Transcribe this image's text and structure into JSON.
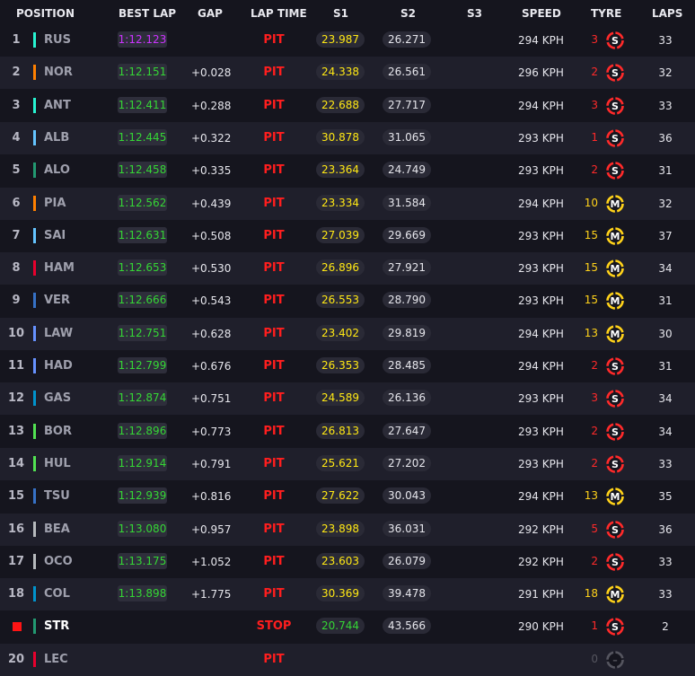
{
  "headers": {
    "position": "POSITION",
    "best_lap": "BEST LAP",
    "gap": "GAP",
    "lap_time": "LAP TIME",
    "s1": "S1",
    "s2": "S2",
    "s3": "S3",
    "speed": "SPEED",
    "tyre": "TYRE",
    "laps": "LAPS"
  },
  "colors": {
    "purple": "#cc33ff",
    "green": "#35d635",
    "yellow": "#ffe814",
    "red": "#ff1e1e",
    "soft": "#ff2a2a",
    "medium": "#ffd21a",
    "unknown": "#55555f",
    "mercedes": "#27f4d2",
    "mclaren": "#ff8000",
    "williams": "#64c4ff",
    "aston_martin": "#229971",
    "ferrari": "#e8002d",
    "red_bull": "#3671c6",
    "racing_bulls": "#6692ff",
    "alpine": "#0093cc",
    "sauber": "#52e252",
    "haas": "#b6babd"
  },
  "rows": [
    {
      "pos": "1",
      "driver": "RUS",
      "team_color": "#27f4d2",
      "best_lap": "1:12.123",
      "best_class": "purple",
      "gap": "",
      "lap_time": "PIT",
      "s1": "23.987",
      "s1_class": "yellow",
      "s2": "26.271",
      "speed": "294 KPH",
      "tyre_age": "3",
      "tyre": "soft",
      "tyre_letter": "S",
      "laps": "33"
    },
    {
      "pos": "2",
      "driver": "NOR",
      "team_color": "#ff8000",
      "best_lap": "1:12.151",
      "best_class": "green",
      "gap": "+0.028",
      "lap_time": "PIT",
      "s1": "24.338",
      "s1_class": "yellow",
      "s2": "26.561",
      "speed": "296 KPH",
      "tyre_age": "2",
      "tyre": "soft",
      "tyre_letter": "S",
      "laps": "32"
    },
    {
      "pos": "3",
      "driver": "ANT",
      "team_color": "#27f4d2",
      "best_lap": "1:12.411",
      "best_class": "green",
      "gap": "+0.288",
      "lap_time": "PIT",
      "s1": "22.688",
      "s1_class": "yellow",
      "s2": "27.717",
      "speed": "294 KPH",
      "tyre_age": "3",
      "tyre": "soft",
      "tyre_letter": "S",
      "laps": "33"
    },
    {
      "pos": "4",
      "driver": "ALB",
      "team_color": "#64c4ff",
      "best_lap": "1:12.445",
      "best_class": "green",
      "gap": "+0.322",
      "lap_time": "PIT",
      "s1": "30.878",
      "s1_class": "yellow",
      "s2": "31.065",
      "speed": "293 KPH",
      "tyre_age": "1",
      "tyre": "soft",
      "tyre_letter": "S",
      "laps": "36"
    },
    {
      "pos": "5",
      "driver": "ALO",
      "team_color": "#229971",
      "best_lap": "1:12.458",
      "best_class": "green",
      "gap": "+0.335",
      "lap_time": "PIT",
      "s1": "23.364",
      "s1_class": "yellow",
      "s2": "24.749",
      "speed": "293 KPH",
      "tyre_age": "2",
      "tyre": "soft",
      "tyre_letter": "S",
      "laps": "31"
    },
    {
      "pos": "6",
      "driver": "PIA",
      "team_color": "#ff8000",
      "best_lap": "1:12.562",
      "best_class": "green",
      "gap": "+0.439",
      "lap_time": "PIT",
      "s1": "23.334",
      "s1_class": "yellow",
      "s2": "31.584",
      "speed": "294 KPH",
      "tyre_age": "10",
      "tyre": "medium",
      "tyre_letter": "M",
      "laps": "32"
    },
    {
      "pos": "7",
      "driver": "SAI",
      "team_color": "#64c4ff",
      "best_lap": "1:12.631",
      "best_class": "green",
      "gap": "+0.508",
      "lap_time": "PIT",
      "s1": "27.039",
      "s1_class": "yellow",
      "s2": "29.669",
      "speed": "293 KPH",
      "tyre_age": "15",
      "tyre": "medium",
      "tyre_letter": "M",
      "laps": "37"
    },
    {
      "pos": "8",
      "driver": "HAM",
      "team_color": "#e8002d",
      "best_lap": "1:12.653",
      "best_class": "green",
      "gap": "+0.530",
      "lap_time": "PIT",
      "s1": "26.896",
      "s1_class": "yellow",
      "s2": "27.921",
      "speed": "293 KPH",
      "tyre_age": "15",
      "tyre": "medium",
      "tyre_letter": "M",
      "laps": "34"
    },
    {
      "pos": "9",
      "driver": "VER",
      "team_color": "#3671c6",
      "best_lap": "1:12.666",
      "best_class": "green",
      "gap": "+0.543",
      "lap_time": "PIT",
      "s1": "26.553",
      "s1_class": "yellow",
      "s2": "28.790",
      "speed": "293 KPH",
      "tyre_age": "15",
      "tyre": "medium",
      "tyre_letter": "M",
      "laps": "31"
    },
    {
      "pos": "10",
      "driver": "LAW",
      "team_color": "#6692ff",
      "best_lap": "1:12.751",
      "best_class": "green",
      "gap": "+0.628",
      "lap_time": "PIT",
      "s1": "23.402",
      "s1_class": "yellow",
      "s2": "29.819",
      "speed": "294 KPH",
      "tyre_age": "13",
      "tyre": "medium",
      "tyre_letter": "M",
      "laps": "30"
    },
    {
      "pos": "11",
      "driver": "HAD",
      "team_color": "#6692ff",
      "best_lap": "1:12.799",
      "best_class": "green",
      "gap": "+0.676",
      "lap_time": "PIT",
      "s1": "26.353",
      "s1_class": "yellow",
      "s2": "28.485",
      "speed": "294 KPH",
      "tyre_age": "2",
      "tyre": "soft",
      "tyre_letter": "S",
      "laps": "31"
    },
    {
      "pos": "12",
      "driver": "GAS",
      "team_color": "#0093cc",
      "best_lap": "1:12.874",
      "best_class": "green",
      "gap": "+0.751",
      "lap_time": "PIT",
      "s1": "24.589",
      "s1_class": "yellow",
      "s2": "26.136",
      "speed": "293 KPH",
      "tyre_age": "3",
      "tyre": "soft",
      "tyre_letter": "S",
      "laps": "34"
    },
    {
      "pos": "13",
      "driver": "BOR",
      "team_color": "#52e252",
      "best_lap": "1:12.896",
      "best_class": "green",
      "gap": "+0.773",
      "lap_time": "PIT",
      "s1": "26.813",
      "s1_class": "yellow",
      "s2": "27.647",
      "speed": "293 KPH",
      "tyre_age": "2",
      "tyre": "soft",
      "tyre_letter": "S",
      "laps": "34"
    },
    {
      "pos": "14",
      "driver": "HUL",
      "team_color": "#52e252",
      "best_lap": "1:12.914",
      "best_class": "green",
      "gap": "+0.791",
      "lap_time": "PIT",
      "s1": "25.621",
      "s1_class": "yellow",
      "s2": "27.202",
      "speed": "293 KPH",
      "tyre_age": "2",
      "tyre": "soft",
      "tyre_letter": "S",
      "laps": "33"
    },
    {
      "pos": "15",
      "driver": "TSU",
      "team_color": "#3671c6",
      "best_lap": "1:12.939",
      "best_class": "green",
      "gap": "+0.816",
      "lap_time": "PIT",
      "s1": "27.622",
      "s1_class": "yellow",
      "s2": "30.043",
      "speed": "294 KPH",
      "tyre_age": "13",
      "tyre": "medium",
      "tyre_letter": "M",
      "laps": "35"
    },
    {
      "pos": "16",
      "driver": "BEA",
      "team_color": "#b6babd",
      "best_lap": "1:13.080",
      "best_class": "green",
      "gap": "+0.957",
      "lap_time": "PIT",
      "s1": "23.898",
      "s1_class": "yellow",
      "s2": "36.031",
      "speed": "292 KPH",
      "tyre_age": "5",
      "tyre": "soft",
      "tyre_letter": "S",
      "laps": "36"
    },
    {
      "pos": "17",
      "driver": "OCO",
      "team_color": "#b6babd",
      "best_lap": "1:13.175",
      "best_class": "green",
      "gap": "+1.052",
      "lap_time": "PIT",
      "s1": "23.603",
      "s1_class": "yellow",
      "s2": "26.079",
      "speed": "292 KPH",
      "tyre_age": "2",
      "tyre": "soft",
      "tyre_letter": "S",
      "laps": "33"
    },
    {
      "pos": "18",
      "driver": "COL",
      "team_color": "#0093cc",
      "best_lap": "1:13.898",
      "best_class": "green",
      "gap": "+1.775",
      "lap_time": "PIT",
      "s1": "30.369",
      "s1_class": "yellow",
      "s2": "39.478",
      "speed": "291 KPH",
      "tyre_age": "18",
      "tyre": "medium",
      "tyre_letter": "M",
      "laps": "33"
    },
    {
      "pos": "",
      "driver": "STR",
      "team_color": "#229971",
      "best_lap": "",
      "best_class": "",
      "gap": "",
      "lap_time": "STOP",
      "s1": "20.744",
      "s1_class": "green",
      "s2": "43.566",
      "speed": "290 KPH",
      "tyre_age": "1",
      "tyre": "soft",
      "tyre_letter": "S",
      "laps": "2",
      "flag": true,
      "highlight": true
    },
    {
      "pos": "20",
      "driver": "LEC",
      "team_color": "#e8002d",
      "best_lap": "",
      "best_class": "",
      "gap": "",
      "lap_time": "PIT",
      "s1": "",
      "s1_class": "",
      "s2": "",
      "speed": "",
      "tyre_age": "0",
      "tyre": "unknown",
      "tyre_letter": "–",
      "laps": ""
    }
  ]
}
